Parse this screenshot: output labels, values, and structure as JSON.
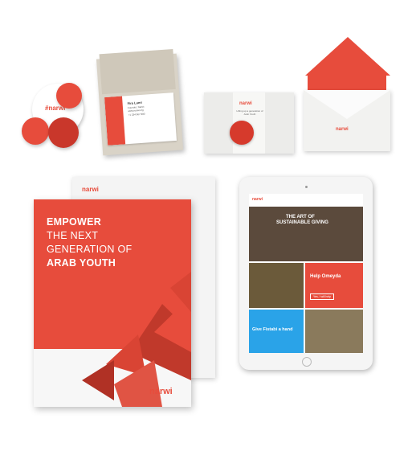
{
  "brand": {
    "name": "narwi",
    "accent": "#e74c3c"
  },
  "badges": {
    "big_label": "#narwi"
  },
  "business_card": {
    "name": "Fira Lueri",
    "lines": [
      "Founder, Narwi",
      "www.narwi.org",
      "+1 234 567 890"
    ]
  },
  "envelope_sealed": {
    "tagline": "Lifting up a generation of Arab Youth"
  },
  "brochure": {
    "headline_line1": "EMPOWER",
    "headline_line2": "THE NEXT",
    "headline_line3": "GENERATION OF",
    "headline_line4": "ARAB YOUTH",
    "footer_logo": "narwi"
  },
  "tablet": {
    "hero_title_line1": "THE ART OF",
    "hero_title_line2": "SUSTAINABLE GIVING",
    "tile1_title": "Help Omeyda",
    "tile1_button": "Yes, I will help",
    "tile2_title": "Give Fistabi a hand"
  }
}
